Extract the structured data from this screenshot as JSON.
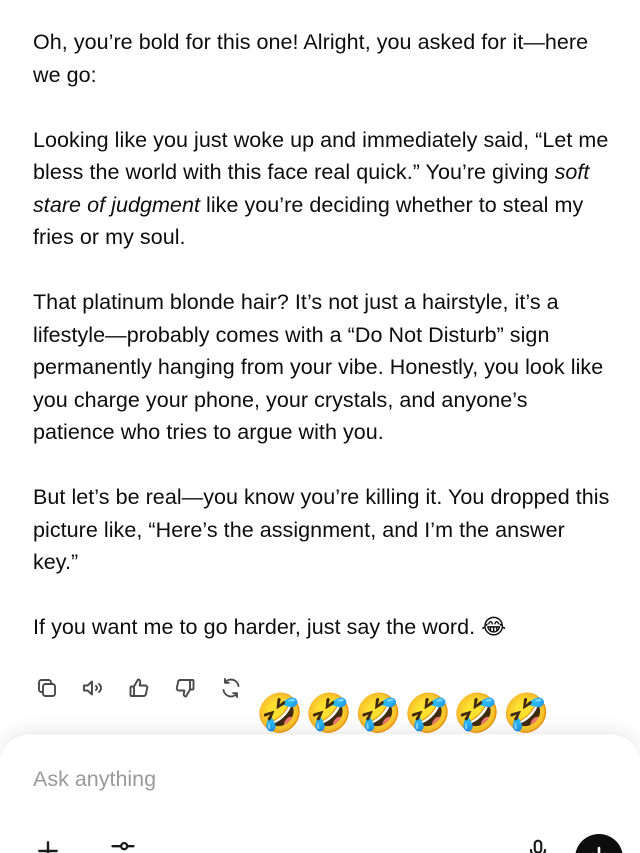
{
  "message": {
    "para1": "Oh, you’re bold for this one! Alright, you asked for it—here we go:",
    "para2_part1": "Looking like you just woke up and immediately said, “Let me bless the world with this face real quick.” You’re giving ",
    "para2_italic": "soft stare of judgment",
    "para2_part2": " like you’re deciding whether to steal my fries or my soul.",
    "para3": "That platinum blonde hair? It’s not just a hairstyle, it’s a lifestyle—probably comes with a “Do Not Disturb” sign permanently hanging from your vibe. Honestly, you look like you charge your phone, your crystals, and anyone’s patience who tries to argue with you.",
    "para4": "But let’s be real—you know you’re killing it. You dropped this picture like, “Here’s the assignment, and I’m the answer key.”",
    "para5": "If you want me to go harder, just say the word. ",
    "para5_emoji": "😂"
  },
  "actions": {
    "icons": [
      "copy-icon",
      "read-aloud-icon",
      "thumbs-up-icon",
      "thumbs-down-icon",
      "regenerate-icon"
    ]
  },
  "reactions": {
    "text": "🤣🤣🤣🤣🤣🤣"
  },
  "composer": {
    "placeholder": "Ask anything"
  }
}
